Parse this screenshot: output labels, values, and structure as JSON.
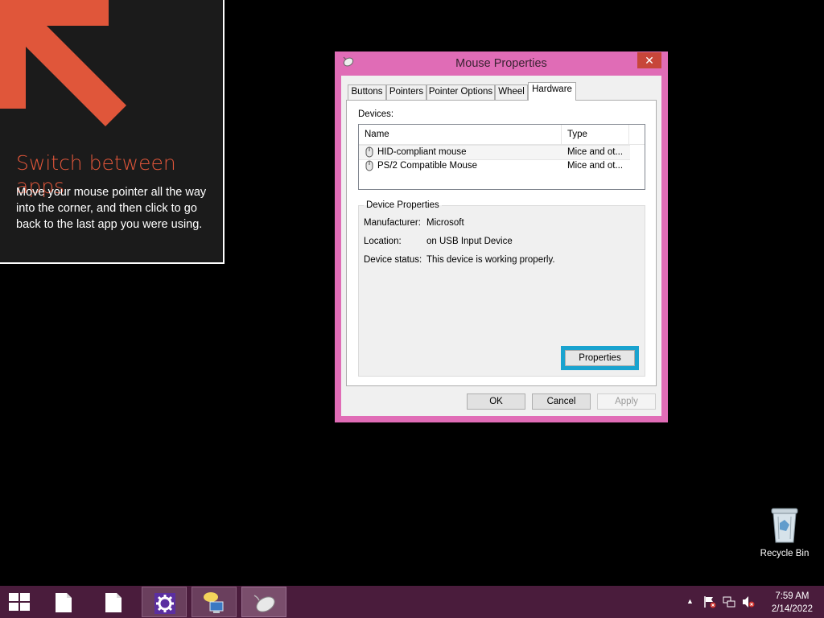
{
  "tip": {
    "title": "Switch between apps",
    "body": "Move your mouse pointer all the way into the corner, and then click to go back to the last app you were using."
  },
  "dialog": {
    "title": "Mouse Properties",
    "close_label": "✕",
    "tabs": [
      {
        "label": "Buttons"
      },
      {
        "label": "Pointers"
      },
      {
        "label": "Pointer Options"
      },
      {
        "label": "Wheel"
      },
      {
        "label": "Hardware"
      }
    ],
    "active_tab": "Hardware",
    "devices_label": "Devices:",
    "columns": {
      "name": "Name",
      "type": "Type"
    },
    "devices": [
      {
        "name": "HID-compliant mouse",
        "type": "Mice and ot..."
      },
      {
        "name": "PS/2 Compatible Mouse",
        "type": "Mice and ot..."
      }
    ],
    "device_properties": {
      "title": "Device Properties",
      "manufacturer_label": "Manufacturer:",
      "manufacturer_value": "Microsoft",
      "location_label": "Location:",
      "location_value": "on USB Input Device",
      "status_label": "Device status:",
      "status_value": "This device is working properly.",
      "properties_button": "Properties"
    },
    "buttons": {
      "ok": "OK",
      "cancel": "Cancel",
      "apply": "Apply"
    }
  },
  "desktop": {
    "recycle_bin": "Recycle Bin"
  },
  "taskbar": {
    "time": "7:59 AM",
    "date": "2/14/2022"
  },
  "colors": {
    "accent_orange": "#e0563a",
    "dialog_frame": "#e06cb6",
    "taskbar": "#4a1c3c",
    "focus_ring": "#1aa3cf"
  }
}
